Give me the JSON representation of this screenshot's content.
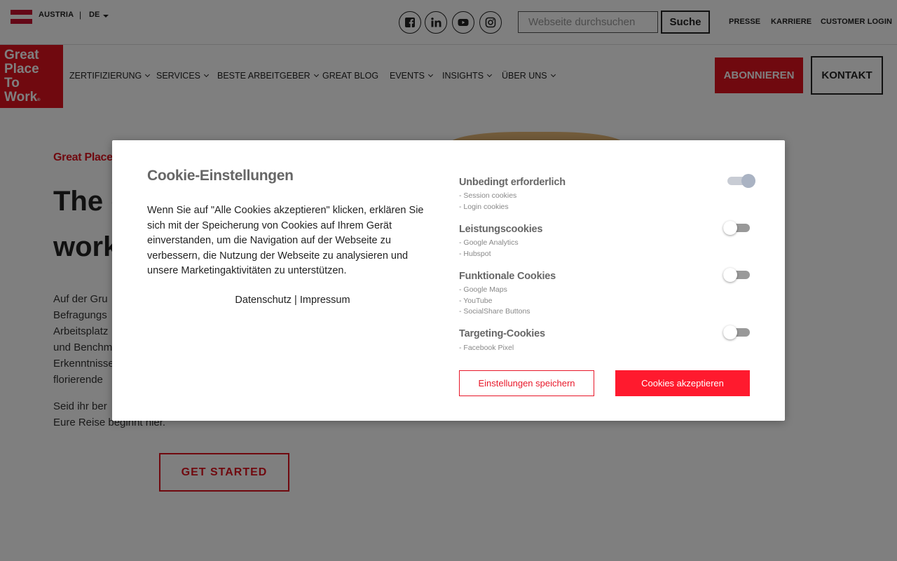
{
  "topbar": {
    "country": "AUSTRIA",
    "separator": "|",
    "language": "DE",
    "flag_colors": [
      "#c8102e",
      "#ffffff",
      "#c8102e"
    ],
    "social_icons": [
      "facebook-icon",
      "linkedin-icon",
      "youtube-icon",
      "instagram-icon"
    ],
    "search_placeholder": "Webseite durchsuchen",
    "search_button": "Suche",
    "links": [
      "PRESSE",
      "KARRIERE",
      "CUSTOMER LOGIN"
    ]
  },
  "logo": {
    "lines": [
      "Great",
      "Place",
      "To",
      "Work"
    ],
    "reg": "®",
    "color": "#e0131f"
  },
  "nav": {
    "items": [
      {
        "label": "ZERTIFIZIERUNG",
        "dropdown": true
      },
      {
        "label": "SERVICES",
        "dropdown": true
      },
      {
        "label": "BESTE ARBEITGEBER",
        "dropdown": true
      },
      {
        "label": "GREAT BLOG",
        "dropdown": false
      },
      {
        "label": "EVENTS",
        "dropdown": true
      },
      {
        "label": "INSIGHTS",
        "dropdown": true
      },
      {
        "label": "ÜBER UNS",
        "dropdown": true
      }
    ],
    "subscribe": "ABONNIEREN",
    "contact": "KONTAKT"
  },
  "hero": {
    "subtitle": "Great Place",
    "title_line1": "The g",
    "title_line2": "work",
    "body_lines": [
      "Auf der Gru",
      "Befragungs",
      "Arbeitsplatz",
      "und Benchm",
      "Erkenntnisse",
      "florierende"
    ],
    "body2_lines": [
      "Seid ihr ber",
      "Eure Reise beginnt hier."
    ],
    "cta": "GET STARTED"
  },
  "cookie_modal": {
    "title": "Cookie-Einstellungen",
    "text": "Wenn Sie auf \"Alle Cookies akzeptieren\" klicken, erklären Sie sich mit der Speicherung von Cookies auf Ihrem Gerät einverstanden, um die Navigation auf der Webseite zu verbessern, die Nutzung der Webseite zu analysieren und unsere Marketingaktivitäten zu unterstützen.",
    "link_privacy": "Datenschutz",
    "link_separator": " | ",
    "link_imprint": "Impressum",
    "categories": [
      {
        "title": "Unbedingt erforderlich",
        "items": [
          "- Session cookies",
          "- Login cookies"
        ],
        "enabled": true
      },
      {
        "title": "Leistungscookies",
        "items": [
          "- Google Analytics",
          "- Hubspot"
        ],
        "enabled": false
      },
      {
        "title": "Funktionale Cookies",
        "items": [
          "- Google Maps",
          "- YouTube",
          "- SocialShare Buttons"
        ],
        "enabled": false
      },
      {
        "title": "Targeting-Cookies",
        "items": [
          "- Facebook Pixel"
        ],
        "enabled": false
      }
    ],
    "save_button": "Einstellungen speichern",
    "accept_button": "Cookies akzeptieren",
    "accent_color": "#ff1a2e"
  }
}
